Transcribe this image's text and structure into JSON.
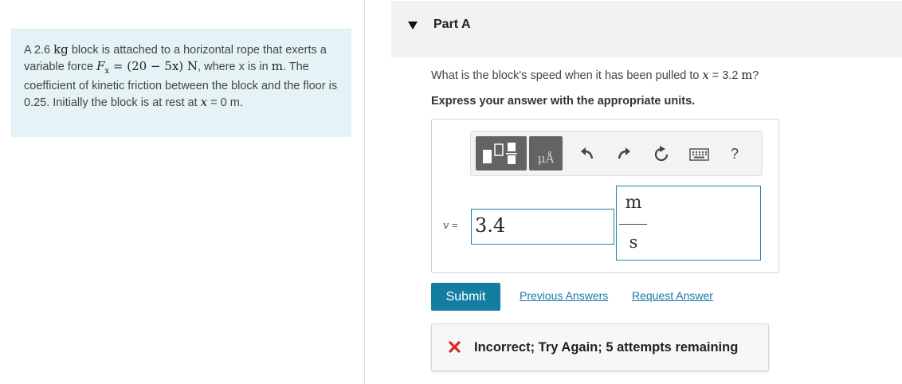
{
  "problem": {
    "prefix": "A 2.6",
    "mass_unit": "kg",
    "t1": " block is attached to a horizontal rope that exerts a variable force ",
    "force_symbol": "F",
    "force_sub": "x",
    "force_expr": " = (20 − 5x) N",
    "t2": ", where x is in ",
    "length_unit": "m",
    "t3": ". The coefficient of kinetic friction between the block and the floor is 0.25. Initially the block is at rest at ",
    "x_var": "x",
    "initial_value": " = 0 m",
    "t4": "."
  },
  "part": {
    "title": "Part A"
  },
  "question": {
    "prefix": "What is the block's speed when it has been pulled to ",
    "var": "x",
    "suffix": " = 3.2 ",
    "unit": "m",
    "end": "?"
  },
  "instruction": "Express your answer with the appropriate units.",
  "toolbar": {
    "units_label": "μÅ",
    "help_label": "?"
  },
  "answer": {
    "var": "v",
    "eq": " =",
    "value": "3.4",
    "unit_numerator": "m",
    "unit_denominator": "s"
  },
  "actions": {
    "submit_label": "Submit",
    "previous_answers_label": "Previous Answers",
    "request_answer_label": "Request Answer"
  },
  "feedback": {
    "text": "Incorrect; Try Again; 5 attempts remaining"
  },
  "colors": {
    "accent": "#137ea2",
    "link": "#1a78a8",
    "error": "#d9252b",
    "problem_bg": "#e5f3f6"
  }
}
